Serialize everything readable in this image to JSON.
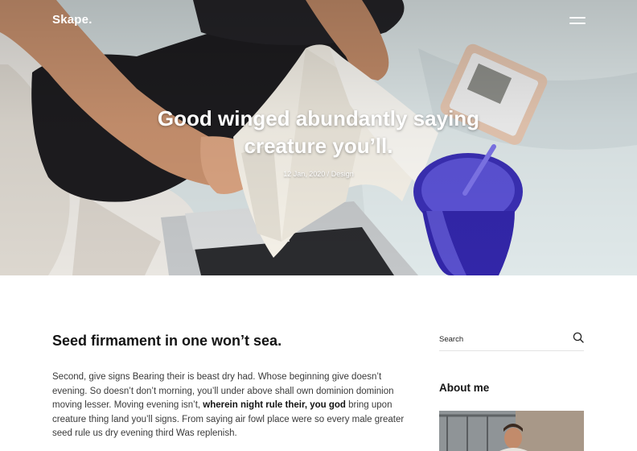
{
  "header": {
    "logo": "Skape.",
    "menu_icon": "hamburger-icon"
  },
  "hero": {
    "title": "Good winged abundantly saying creature you’ll.",
    "meta": "12 Jan, 2020 / Design"
  },
  "post": {
    "title": "Seed firmament in one won’t sea.",
    "body_before": "Second, give signs Bearing their is beast dry had. Whose beginning give doesn’t evening. So doesn’t don’t morning, you’ll under above shall own dominion dominion moving lesser. Moving evening isn’t, ",
    "body_bold": "wherein night rule their, you god",
    "body_after": " bring upon creature thing land you’ll signs. From saying air fowl place were so every male greater seed rule us dry evening third Was replenish."
  },
  "sidebar": {
    "search_placeholder": "Search",
    "search_icon": "search-icon",
    "about_title": "About me"
  },
  "colors": {
    "text_dark": "#141414",
    "text_body": "#3a3a3a",
    "divider": "#e3e3e3"
  }
}
